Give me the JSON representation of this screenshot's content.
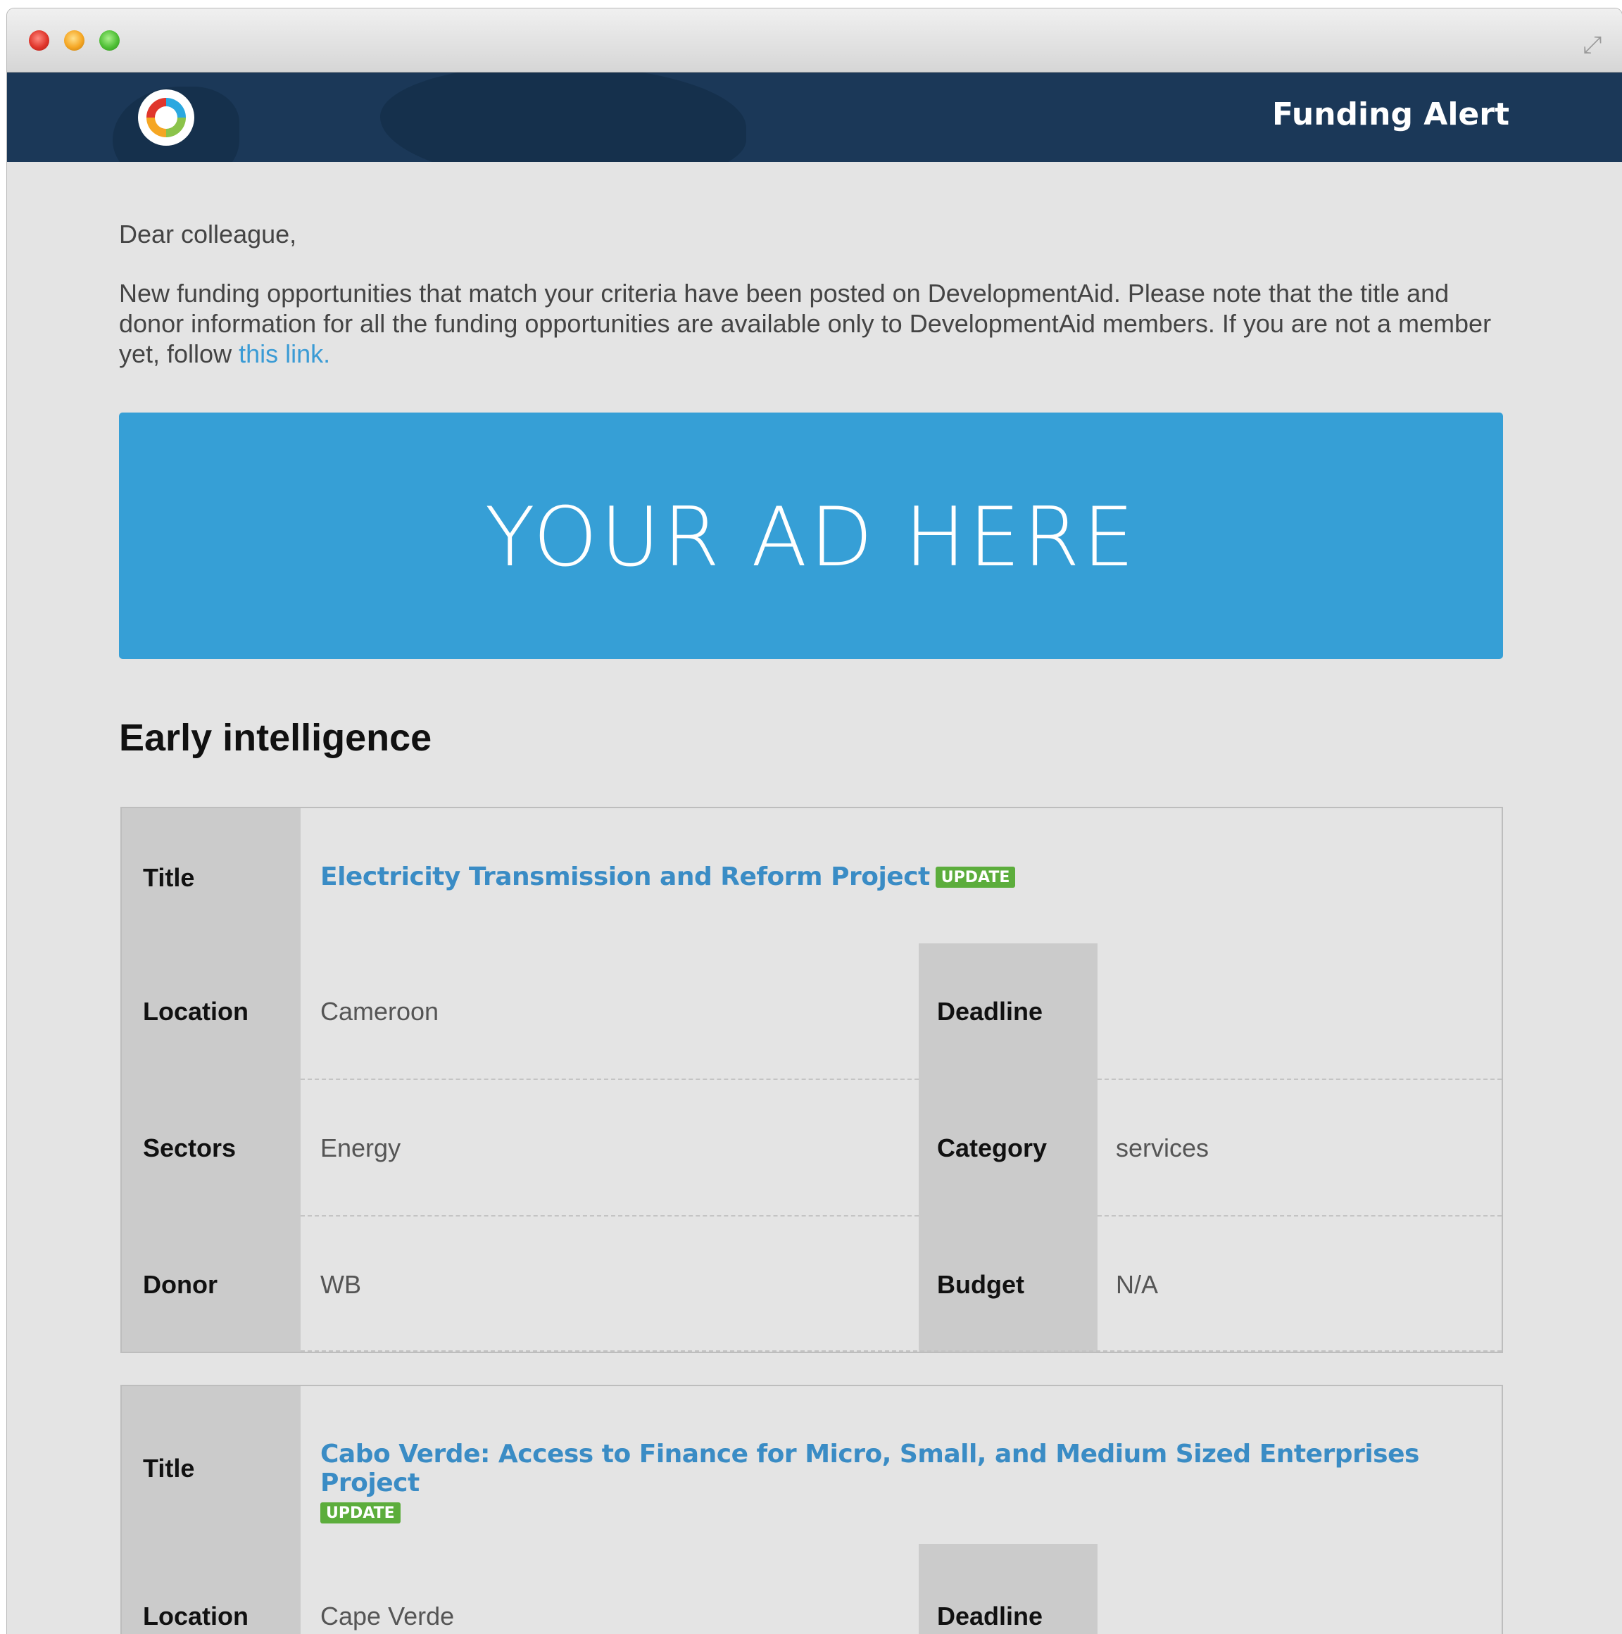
{
  "window": {
    "expand_icon": "expand-icon"
  },
  "header": {
    "title": "Funding Alert",
    "logo_icon": "developmentaid-logo-icon"
  },
  "email": {
    "greeting": "Dear colleague,",
    "intro_text": "New funding opportunities that match your criteria have been posted on DevelopmentAid. Please note that the title and donor information for all the funding opportunities are available only to DevelopmentAid members. If you are not a member yet, follow ",
    "intro_link": "this link",
    "intro_end": "."
  },
  "ad": {
    "text": "YOUR AD HERE",
    "color": "#369fd6"
  },
  "section": {
    "title": "Early intelligence"
  },
  "labels": {
    "title": "Title",
    "location": "Location",
    "deadline": "Deadline",
    "sectors": "Sectors",
    "category": "Category",
    "donor": "Donor",
    "budget": "Budget"
  },
  "cards": [
    {
      "title": "Electricity Transmission and Reform Project",
      "badge": "UPDATE",
      "location": "Cameroon",
      "deadline": "",
      "sectors": "Energy",
      "category": "services",
      "donor": "WB",
      "budget": "N/A"
    },
    {
      "title": "Cabo Verde: Access to Finance for Micro, Small, and Medium Sized Enterprises Project",
      "badge": "UPDATE",
      "location": "Cape Verde",
      "deadline": ""
    }
  ],
  "colors": {
    "header": "#1b3858",
    "link": "#3a8cc5",
    "badge": "#5cad3c"
  }
}
